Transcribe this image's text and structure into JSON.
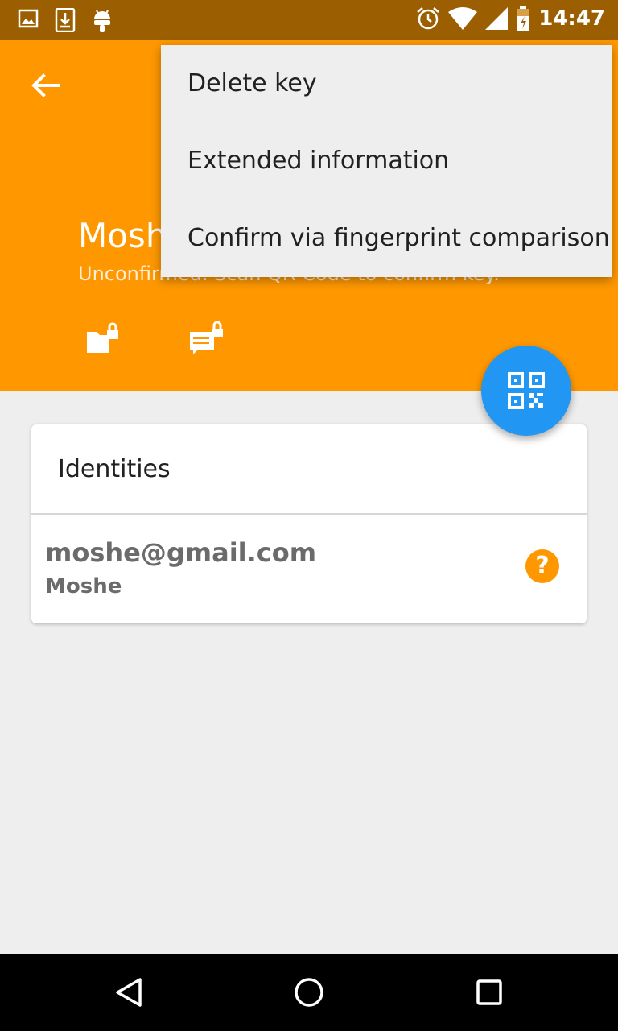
{
  "status_bar": {
    "time": "14:47",
    "left_icons": [
      "image-icon",
      "download-icon",
      "android-icon"
    ],
    "right_icons": [
      "alarm-icon",
      "wifi-icon",
      "signal-icon",
      "battery-icon"
    ]
  },
  "header": {
    "key_name": "Mosh",
    "key_status": "Unconfirmed. Scan QR Code to confirm key.",
    "action_icons": [
      "encrypt-files-icon",
      "encrypt-text-icon"
    ],
    "accent_color": "#ff9800"
  },
  "fab": {
    "icon": "qr-code-icon",
    "color": "#2196f3"
  },
  "identities_card": {
    "title": "Identities",
    "items": [
      {
        "email": "moshe@gmail.com",
        "name": "Moshe",
        "status_icon": "help-icon"
      }
    ]
  },
  "overflow_menu": {
    "items": [
      {
        "label": "Delete key"
      },
      {
        "label": "Extended information"
      },
      {
        "label": "Confirm via fingerprint comparison"
      }
    ]
  },
  "nav_bar": {
    "buttons": [
      "back-nav-icon",
      "home-nav-icon",
      "recents-nav-icon"
    ]
  }
}
